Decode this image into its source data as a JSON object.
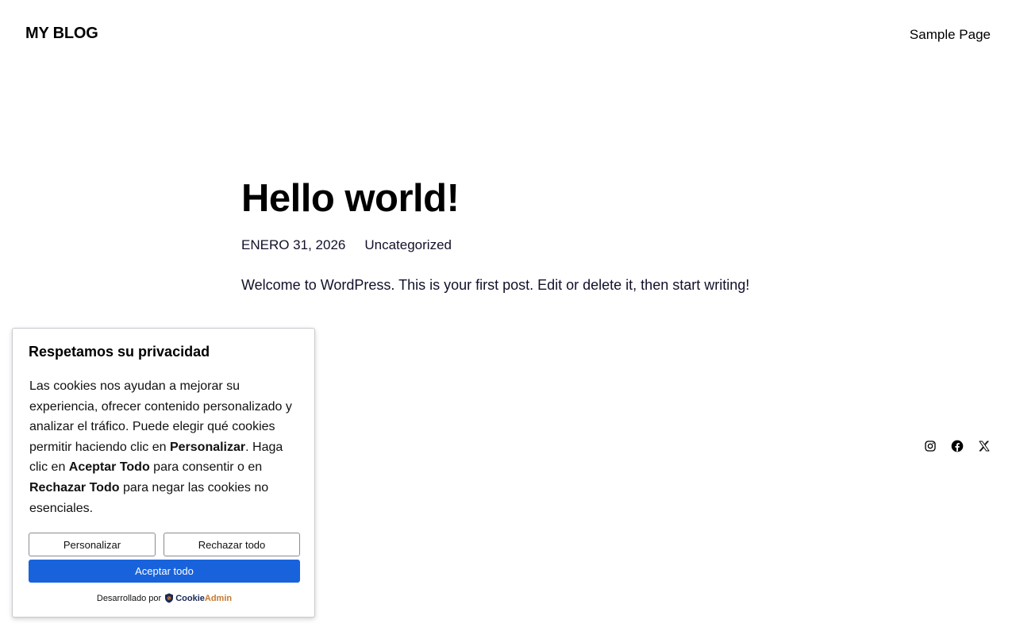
{
  "header": {
    "site_title": "MY BLOG",
    "nav": [
      {
        "label": "Sample Page"
      }
    ]
  },
  "post": {
    "title": "Hello world!",
    "date": "ENERO 31, 2026",
    "category": "Uncategorized",
    "body": "Welcome to WordPress. This is your first post. Edit or delete it, then start writing!"
  },
  "social": [
    {
      "icon": "instagram-icon"
    },
    {
      "icon": "facebook-icon"
    },
    {
      "icon": "x-icon"
    }
  ],
  "cookie_banner": {
    "title": "Respetamos su privacidad",
    "text_parts": [
      "Las cookies nos ayudan a mejorar su experiencia, ofrecer contenido personalizado y analizar el tráfico. Puede elegir qué cookies permitir haciendo clic en ",
      "Personalizar",
      ". Haga clic en ",
      "Aceptar Todo",
      " para consentir o en ",
      "Rechazar Todo",
      " para negar las cookies no esenciales."
    ],
    "buttons": {
      "customize": "Personalizar",
      "reject": "Rechazar todo",
      "accept": "Aceptar todo"
    },
    "powered_by": "Desarrollado por",
    "brand": {
      "part1": "Cookie",
      "part2": "Admin"
    },
    "colors": {
      "accept": "#1863dc",
      "brand_dark": "#1b2a55",
      "brand_accent": "#c7772d"
    }
  }
}
